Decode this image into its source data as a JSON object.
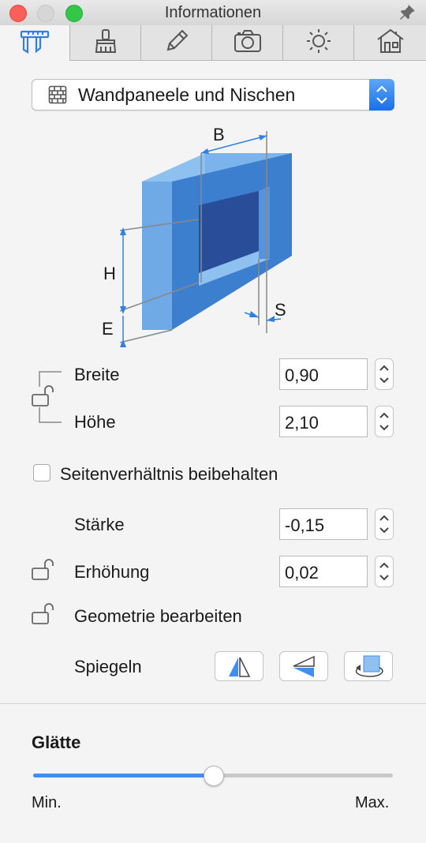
{
  "window": {
    "title": "Informationen"
  },
  "tabs": [
    {
      "icon": "caliper-icon",
      "active": true
    },
    {
      "icon": "brush-icon",
      "active": false
    },
    {
      "icon": "pencil-icon",
      "active": false
    },
    {
      "icon": "camera-icon",
      "active": false
    },
    {
      "icon": "sun-icon",
      "active": false
    },
    {
      "icon": "house-icon",
      "active": false
    }
  ],
  "object_type": {
    "icon": "brick-icon",
    "selected": "Wandpaneele und Nischen"
  },
  "diagram": {
    "label_b": "B",
    "label_h": "H",
    "label_e": "E",
    "label_s": "S"
  },
  "dimensions": {
    "width": {
      "label": "Breite",
      "value": "0,90"
    },
    "height": {
      "label": "Höhe",
      "value": "2,10"
    }
  },
  "aspect": {
    "label": "Seitenverhältnis beibehalten",
    "checked": false
  },
  "thickness": {
    "label": "Stärke",
    "value": "-0,15"
  },
  "elevation": {
    "label": "Erhöhung",
    "value": "0,02"
  },
  "geometry": {
    "label": "Geometrie bearbeiten"
  },
  "mirror": {
    "label": "Spiegeln"
  },
  "smoothness": {
    "title": "Glätte",
    "min_label": "Min.",
    "max_label": "Max.",
    "level": 0.5
  },
  "colors": {
    "accent": "#3e8ff5",
    "shape_front": "#3d7fcf",
    "shape_side": "#6fa9e6",
    "shape_top": "#8ec1f0",
    "shape_inner": "#2a4d9a"
  }
}
